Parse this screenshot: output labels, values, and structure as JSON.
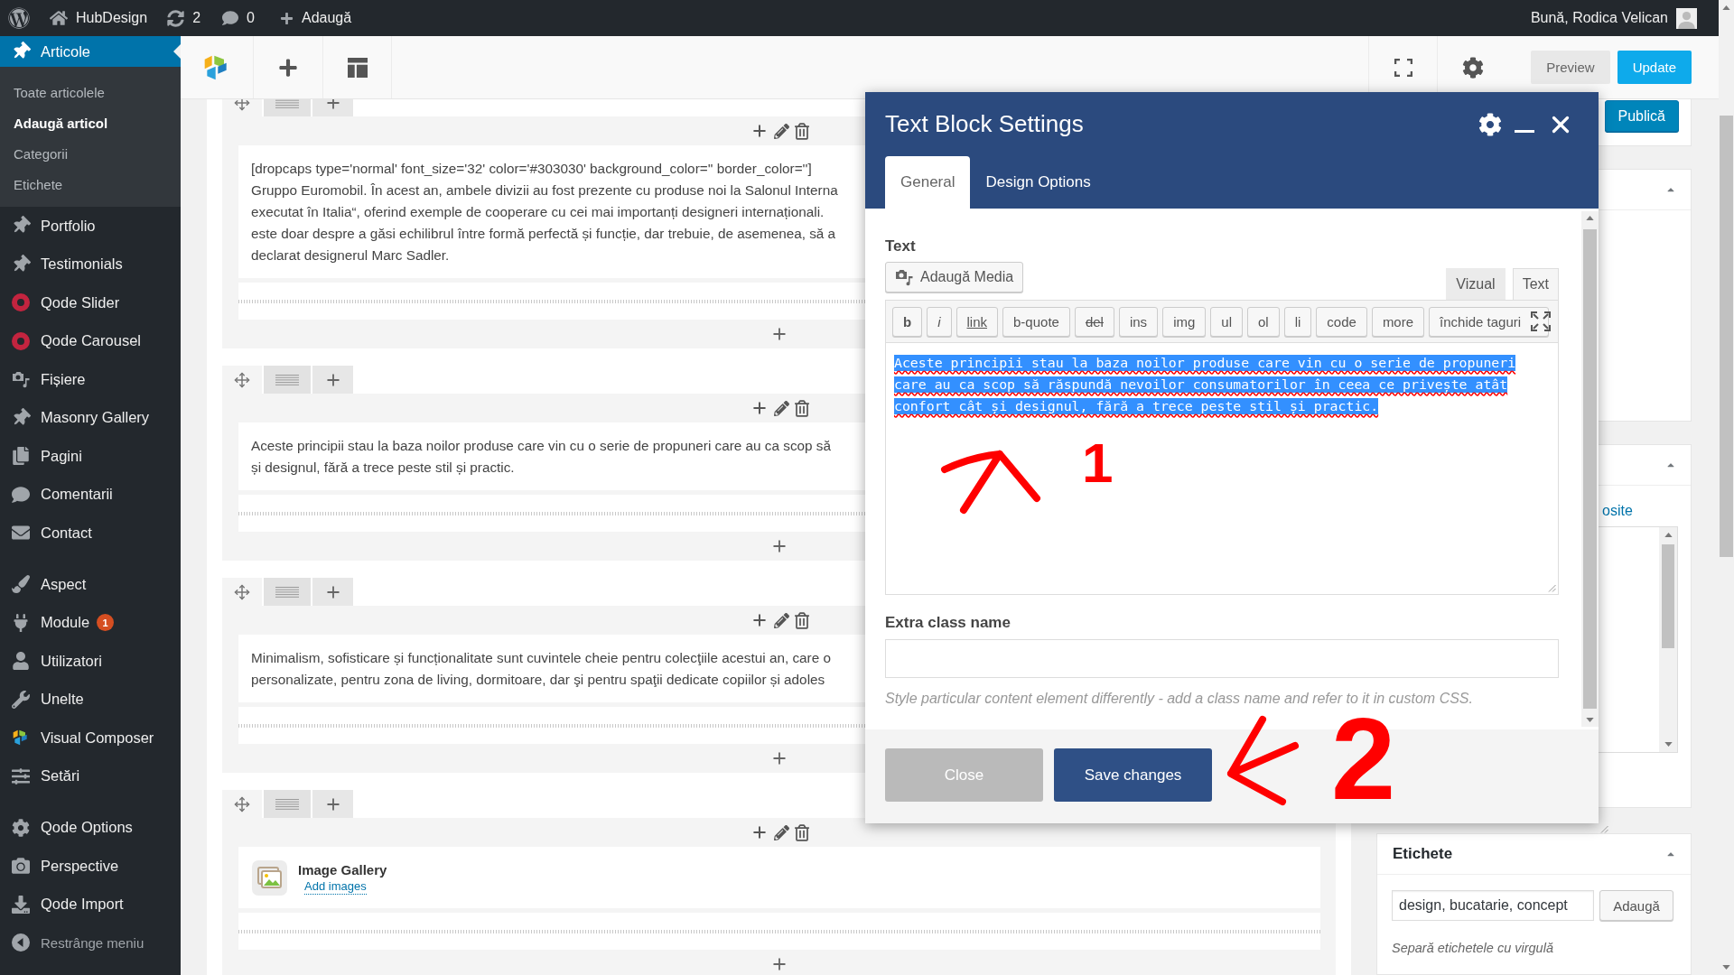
{
  "admin_bar": {
    "site_name": "HubDesign",
    "updates": "2",
    "comments": "0",
    "new_label": "Adaugă",
    "greeting": "Bună, Rodica Velican"
  },
  "sidebar": {
    "groups": [
      [
        {
          "label": "Articole",
          "selected": true,
          "children": [
            {
              "label": "Toate articolele",
              "selected": false
            },
            {
              "label": "Adaugă articol",
              "selected": true
            },
            {
              "label": "Categorii",
              "selected": false
            },
            {
              "label": "Etichete",
              "selected": false
            }
          ]
        },
        {
          "label": "Portfolio",
          "selected": false
        },
        {
          "label": "Testimonials",
          "selected": false
        },
        {
          "label": "Qode Slider",
          "selected": false
        },
        {
          "label": "Qode Carousel",
          "selected": false
        },
        {
          "label": "Fișiere",
          "selected": false
        },
        {
          "label": "Masonry Gallery",
          "selected": false
        },
        {
          "label": "Pagini",
          "selected": false
        },
        {
          "label": "Comentarii",
          "selected": false
        },
        {
          "label": "Contact",
          "selected": false
        }
      ],
      [
        {
          "label": "Aspect",
          "selected": false
        },
        {
          "label": "Module",
          "selected": false,
          "badge": "1"
        },
        {
          "label": "Utilizatori",
          "selected": false
        },
        {
          "label": "Unelte",
          "selected": false
        },
        {
          "label": "Visual Composer",
          "selected": false
        },
        {
          "label": "Setări",
          "selected": false
        }
      ],
      [
        {
          "label": "Qode Options",
          "selected": false
        },
        {
          "label": "Perspective",
          "selected": false
        },
        {
          "label": "Qode Import",
          "selected": false
        }
      ]
    ],
    "collapse_label": "Restrânge meniu"
  },
  "toolbar": {
    "buttons": [
      {
        "label": "Preview",
        "kind": "secondary"
      },
      {
        "label": "Update",
        "kind": "primary"
      }
    ]
  },
  "rows": [
    {
      "kind": "text",
      "lines": [
        "[dropcaps type='normal' font_size='32' color='#303030' background_color='' border_color='']",
        "Gruppo Euromobil. În acest an, ambele divizii au fost prezente cu produse noi la Salonul Interna",
        "executat în Italia“, oferind exemple de cooperare cu cei mai importanți designeri internaționali.",
        "este doar despre a găsi echilibrul între formă perfectă și funcție, dar trebuie, de asemenea, să a",
        "declarat designerul Marc Sadler."
      ]
    },
    {
      "kind": "text",
      "lines": [
        "Aceste principii stau la baza noilor produse care vin cu o serie de propuneri care au ca scop să",
        "și designul, fără a trece peste stil și practic."
      ]
    },
    {
      "kind": "text",
      "lines": [
        "Minimalism, sofisticare și funcționalitate sunt cuvintele cheie pentru colecţiile acestui an, care o",
        "personalizate, pentru zona de living, dormitoare, dar şi pentru spaţii dedicate copiilor și adoles"
      ]
    },
    {
      "kind": "gallery",
      "title": "Image Gallery",
      "link": "Add images"
    }
  ],
  "side_panel": {
    "publish_button": "Publică",
    "categories_tab": "osite",
    "tags": {
      "title": "Etichete",
      "value": "design, bucatarie, concept",
      "button": "Adaugă",
      "hint": "Separă etichetele cu virgulă"
    }
  },
  "modal": {
    "title": "Text Block Settings",
    "tabs": [
      {
        "label": "General",
        "selected": true
      },
      {
        "label": "Design Options",
        "selected": false
      }
    ],
    "text_label": "Text",
    "media_button": "Adaugă Media",
    "editor_tabs": [
      {
        "label": "Vizual",
        "selected": false
      },
      {
        "label": "Text",
        "selected": true
      }
    ],
    "quicktags": [
      {
        "label": "b",
        "kind": "bold"
      },
      {
        "label": "i",
        "kind": "italic"
      },
      {
        "label": "link",
        "kind": "underline"
      },
      {
        "label": "b-quote",
        "kind": "plain"
      },
      {
        "label": "del",
        "kind": "strike"
      },
      {
        "label": "ins",
        "kind": "plain"
      },
      {
        "label": "img",
        "kind": "plain"
      },
      {
        "label": "ul",
        "kind": "plain"
      },
      {
        "label": "ol",
        "kind": "plain"
      },
      {
        "label": "li",
        "kind": "plain"
      },
      {
        "label": "code",
        "kind": "plain"
      },
      {
        "label": "more",
        "kind": "plain"
      },
      {
        "label": "închide taguri",
        "kind": "plain"
      }
    ],
    "content": "Aceste principii stau la baza noilor produse care vin cu o serie de propuneri care au ca scop să răspundă nevoilor consumatorilor în ceea ce privește atât confort cât și designul, fără a trece peste stil și practic.",
    "content_selected": true,
    "class_label": "Extra class name",
    "hint": "Style particular content element differently - add a class name and refer to it in custom CSS.",
    "buttons": [
      {
        "label": "Close",
        "kind": "secondary"
      },
      {
        "label": "Save changes",
        "kind": "primary"
      }
    ]
  },
  "annotations": [
    {
      "kind": "up",
      "label": "1"
    },
    {
      "kind": "left",
      "label": "2"
    }
  ]
}
